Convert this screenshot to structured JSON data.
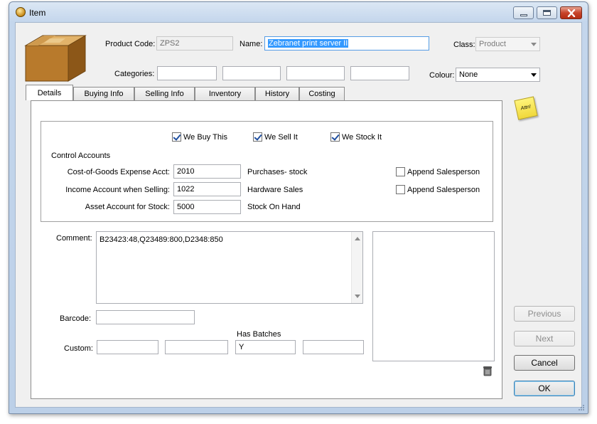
{
  "window": {
    "title": "Item"
  },
  "header": {
    "product_code_label": "Product Code:",
    "product_code_value": "ZPS2",
    "name_label": "Name:",
    "name_value": "Zebranet print server II",
    "class_label": "Class:",
    "class_value": "Product",
    "categories_label": "Categories:",
    "categories": [
      "",
      "",
      "",
      ""
    ],
    "colour_label": "Colour:",
    "colour_value": "None"
  },
  "tabs": [
    {
      "label": "Details",
      "active": true
    },
    {
      "label": "Buying Info"
    },
    {
      "label": "Selling Info"
    },
    {
      "label": "Inventory"
    },
    {
      "label": "History"
    },
    {
      "label": "Costing"
    }
  ],
  "details": {
    "we_buy_this": {
      "label": "We Buy This",
      "checked": true
    },
    "we_sell_it": {
      "label": "We Sell It",
      "checked": true
    },
    "we_stock_it": {
      "label": "We Stock It",
      "checked": true
    },
    "control_accounts_label": "Control Accounts",
    "accounts": [
      {
        "label": "Cost-of-Goods Expense Acct:",
        "value": "2010",
        "description": "Purchases- stock",
        "append_label": "Append Salesperson",
        "append_checked": false
      },
      {
        "label": "Income Account when Selling:",
        "value": "1022",
        "description": "Hardware Sales",
        "append_label": "Append Salesperson",
        "append_checked": false
      },
      {
        "label": "Asset Account for Stock:",
        "value": "5000",
        "description": "Stock On Hand"
      }
    ],
    "comment_label": "Comment:",
    "comment_value": "B23423:48,Q23489:800,D2348:850",
    "barcode_label": "Barcode:",
    "barcode_value": "",
    "custom_label": "Custom:",
    "custom_values": [
      "",
      "",
      "Y",
      ""
    ],
    "has_batches_label": "Has Batches"
  },
  "note_icon_text": "Attn!",
  "buttons": {
    "previous": "Previous",
    "next": "Next",
    "cancel": "Cancel",
    "ok": "OK"
  }
}
